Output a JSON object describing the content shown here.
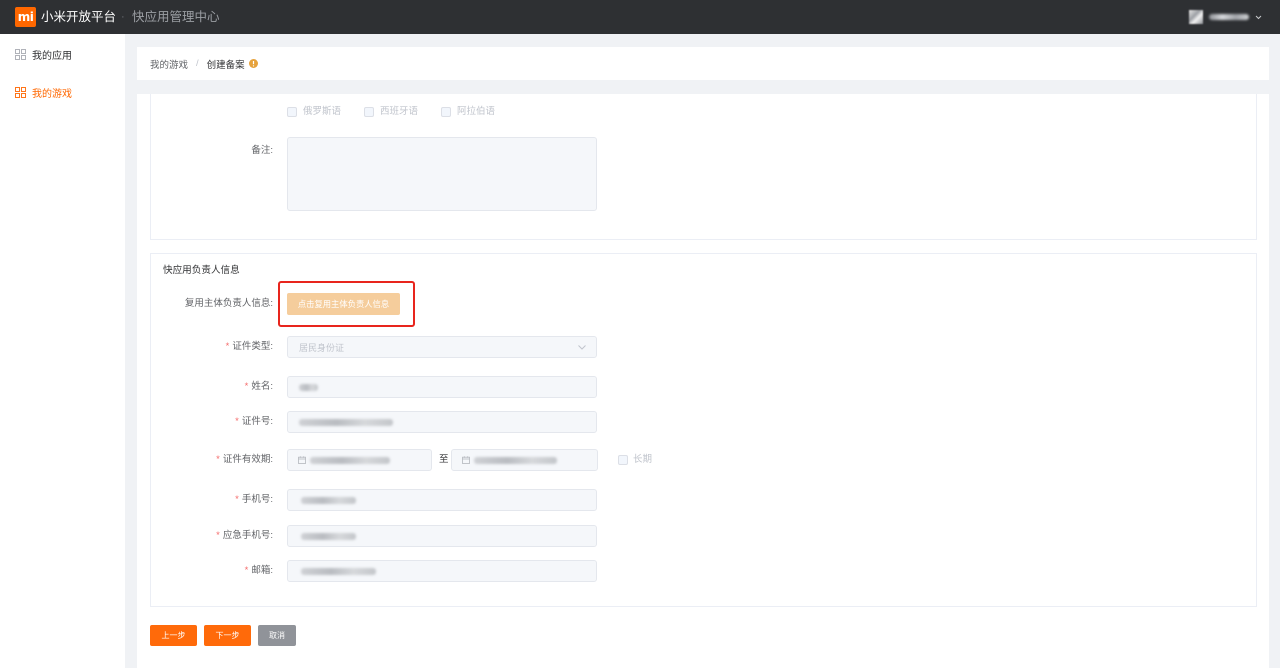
{
  "topbar": {
    "logo_text": "mi",
    "brand": "小米开放平台",
    "separator": "·",
    "subtitle": "快应用管理中心",
    "user_menu_icon": "chevron-down-icon"
  },
  "sidebar": {
    "items": [
      {
        "label": "我的应用",
        "icon": "apps-grid-icon",
        "active": false
      },
      {
        "label": "我的游戏",
        "icon": "apps-grid-icon",
        "active": true
      }
    ]
  },
  "breadcrumb": {
    "items": [
      "我的游戏",
      "创建备案"
    ],
    "separator": "/",
    "status_icon": "warning-circle-icon"
  },
  "language_section": {
    "options": [
      {
        "label": "俄罗斯语",
        "checked": false
      },
      {
        "label": "西班牙语",
        "checked": false
      },
      {
        "label": "阿拉伯语",
        "checked": false
      }
    ],
    "remark_label": "备注:"
  },
  "owner_section": {
    "title": "快应用负责人信息",
    "reuse_label": "复用主体负责人信息:",
    "reuse_button": "点击复用主体负责人信息",
    "required_mark": "*",
    "id_type": {
      "label": "证件类型:",
      "value": "居民身份证",
      "icon": "chevron-down-icon"
    },
    "name": {
      "label": "姓名:"
    },
    "id_number": {
      "label": "证件号:"
    },
    "validity": {
      "label": "证件有效期:",
      "range_separator": "至",
      "long_term_label": "长期",
      "long_term_checked": false,
      "icon": "calendar-icon"
    },
    "phone": {
      "label": "手机号:"
    },
    "emergency_phone": {
      "label": "应急手机号:"
    },
    "email": {
      "label": "邮箱:"
    }
  },
  "actions": {
    "prev": "上一步",
    "next": "下一步",
    "cancel": "取消"
  },
  "colors": {
    "accent": "#ff6700",
    "topbar": "#2e3033",
    "required": "#f56c6c",
    "highlight": "#e8251d",
    "reuse": "#f5cd9c",
    "cancel": "#909399",
    "primary-btn": "#ff6a0a",
    "warn": "#e6a23c"
  }
}
